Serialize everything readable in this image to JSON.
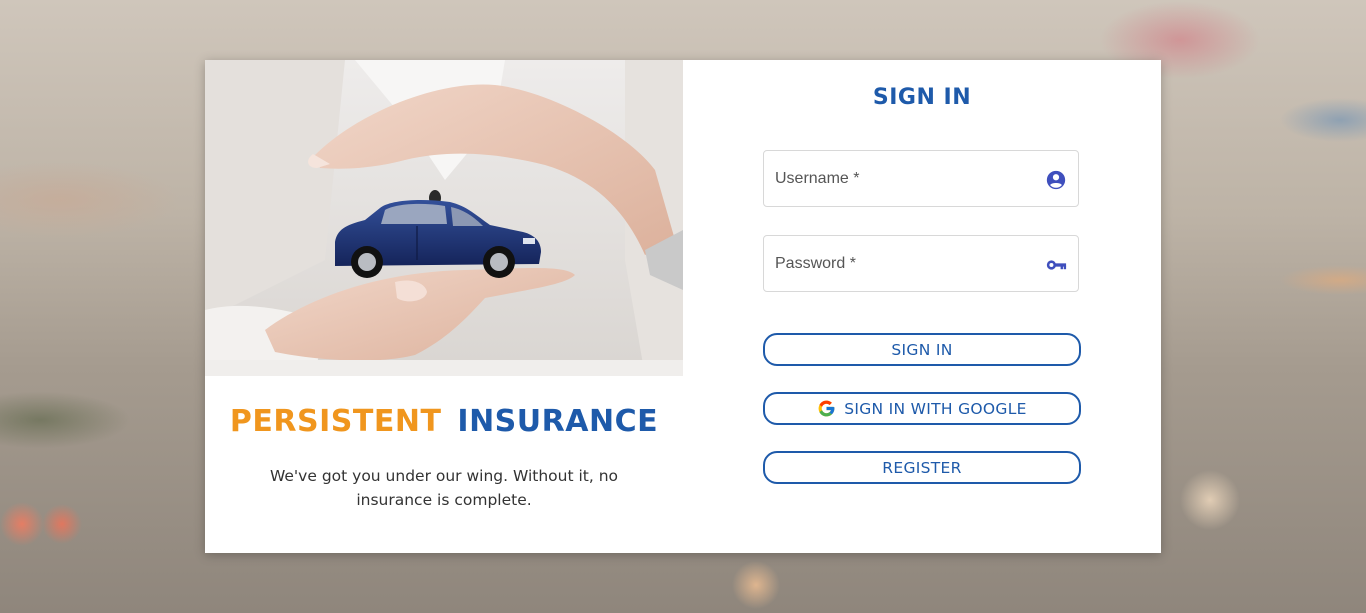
{
  "brand": {
    "word1": "PERSISTENT",
    "word2": "INSURANCE",
    "tagline": "We've got you under our wing. Without it, no insurance is complete.",
    "word1_color": "#f0961e",
    "word2_color": "#1e5aaa"
  },
  "hero": {
    "image": "hands-protecting-car-image",
    "car_color": "#1d2f6b"
  },
  "form": {
    "title": "SIGN IN",
    "username": {
      "placeholder": "Username *",
      "value": "",
      "icon": "account-circle-icon"
    },
    "password": {
      "placeholder": "Password *",
      "value": "",
      "icon": "key-icon"
    },
    "accent_color": "#1e5aaa"
  },
  "buttons": {
    "signin_label": "SIGN IN",
    "google_label": "SIGN IN WITH GOOGLE",
    "google_icon": "google-g-icon",
    "register_label": "REGISTER"
  }
}
